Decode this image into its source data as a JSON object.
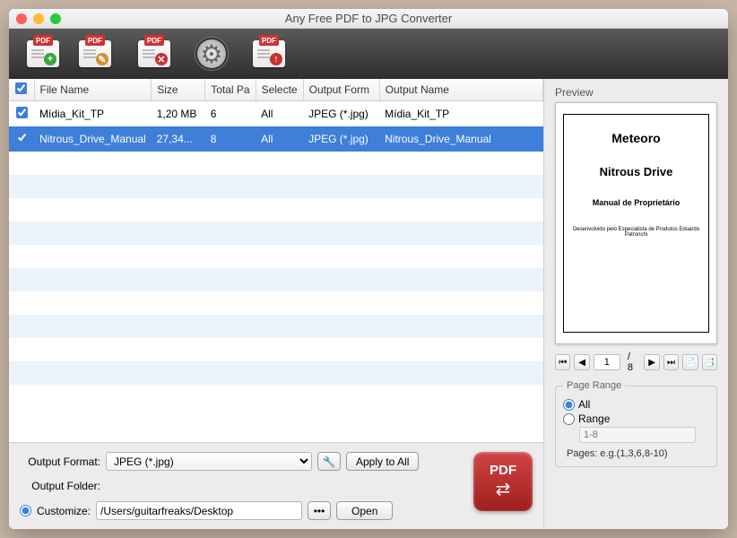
{
  "window": {
    "title": "Any Free PDF to JPG Converter"
  },
  "toolbar": {
    "add_icon": "add-pdf",
    "edit_icon": "edit-pdf",
    "delete_icon": "delete-pdf",
    "settings_icon": "settings",
    "upload_icon": "upload-pdf",
    "badge": "PDF"
  },
  "table": {
    "headers": {
      "checkbox": "",
      "filename": "File Name",
      "size": "Size",
      "total_pages": "Total Pa",
      "selected": "Selecte",
      "output_format": "Output Form",
      "output_name": "Output Name"
    },
    "rows": [
      {
        "checked": true,
        "selected_row": false,
        "filename": "Mídia_Kit_TP",
        "size": "1,20 MB",
        "total_pages": "6",
        "selected": "All",
        "output_format": "JPEG (*.jpg)",
        "output_name": "Mídia_Kit_TP"
      },
      {
        "checked": true,
        "selected_row": true,
        "filename": "Nitrous_Drive_Manual",
        "size": "27,34...",
        "total_pages": "8",
        "selected": "All",
        "output_format": "JPEG (*.jpg)",
        "output_name": "Nitrous_Drive_Manual"
      }
    ]
  },
  "output": {
    "format_label": "Output Format:",
    "format_value": "JPEG (*.jpg)",
    "apply_all": "Apply to All",
    "folder_label": "Output Folder:",
    "customize_label": "Customize:",
    "customize_path": "/Users/guitarfreaks/Desktop",
    "browse": "•••",
    "open": "Open",
    "convert_badge": "PDF"
  },
  "preview": {
    "label": "Preview",
    "doc": {
      "line1": "Meteoro",
      "line2": "Nitrous Drive",
      "line3": "Manual de Proprietário",
      "line4": "Desenvolvido pelo Especialista de Produtos Eduardo Patronchi"
    },
    "page_current": "1",
    "page_total": "/ 8"
  },
  "page_range": {
    "legend": "Page Range",
    "all": "All",
    "range": "Range",
    "range_placeholder": "1-8",
    "hint": "Pages: e.g.(1,3,6,8-10)"
  }
}
